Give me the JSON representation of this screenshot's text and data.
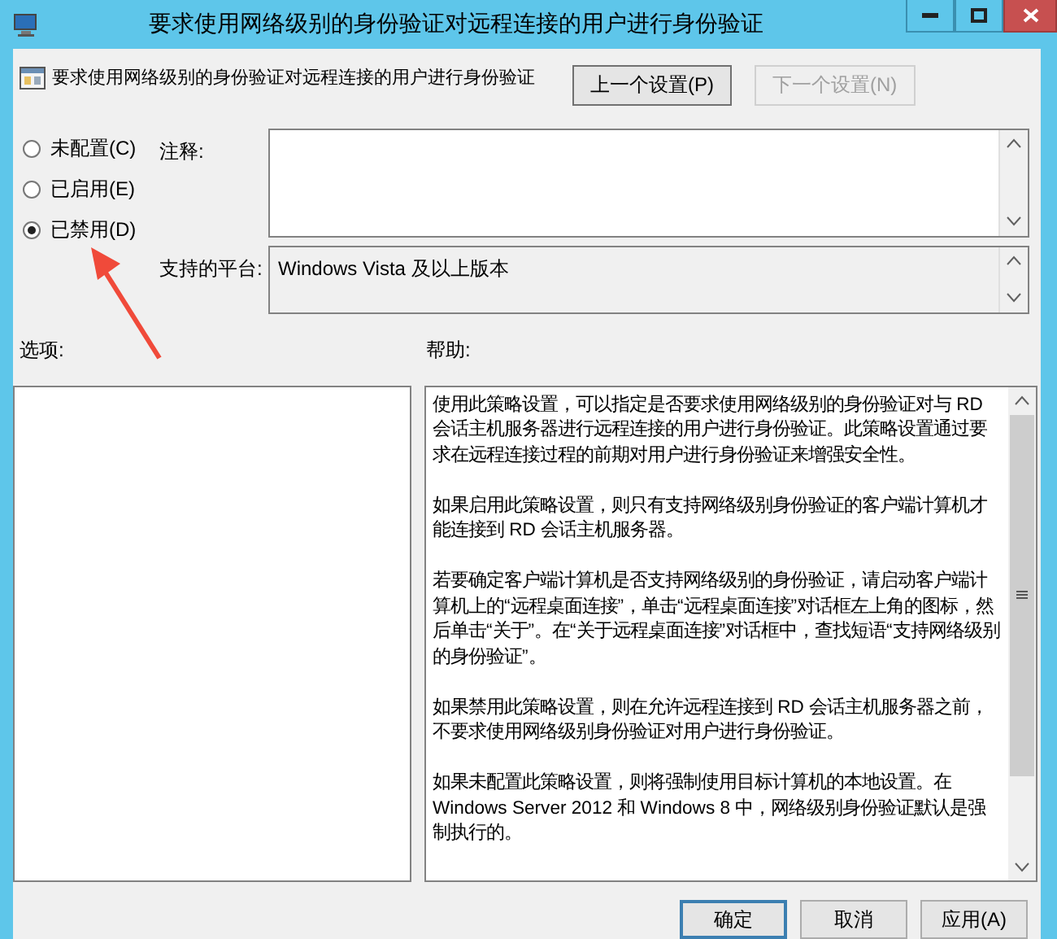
{
  "window": {
    "title": "要求使用网络级别的身份验证对远程连接的用户进行身份验证"
  },
  "header": {
    "policy_name": "要求使用网络级别的身份验证对远程连接的用户进行身份验证",
    "buttons": [
      {
        "label": "上一个设置(P)",
        "disabled": false
      },
      {
        "label": "下一个设置(N)",
        "disabled": true
      }
    ]
  },
  "state_options": [
    {
      "label": "未配置(C)",
      "selected": false
    },
    {
      "label": "已启用(E)",
      "selected": false
    },
    {
      "label": "已禁用(D)",
      "selected": true
    }
  ],
  "comment": {
    "label": "注释:"
  },
  "platform": {
    "label": "支持的平台:",
    "value": "Windows Vista 及以上版本"
  },
  "options_panel": {
    "label": "选项:"
  },
  "help": {
    "label": "帮助:",
    "paragraphs": [
      "使用此策略设置，可以指定是否要求使用网络级别的身份验证对与 RD 会话主机服务器进行远程连接的用户进行身份验证。此策略设置通过要求在远程连接过程的前期对用户进行身份验证来增强安全性。",
      "如果启用此策略设置，则只有支持网络级别身份验证的客户端计算机才能连接到 RD 会话主机服务器。",
      "若要确定客户端计算机是否支持网络级别的身份验证，请启动客户端计算机上的“远程桌面连接”，单击“远程桌面连接”对话框左上角的图标，然后单击“关于”。在“关于远程桌面连接”对话框中，查找短语“支持网络级别的身份验证”。",
      "如果禁用此策略设置，则在允许远程连接到 RD 会话主机服务器之前，不要求使用网络级别身份验证对用户进行身份验证。",
      "如果未配置此策略设置，则将强制使用目标计算机的本地设置。在 Windows Server 2012 和 Windows 8 中，网络级别身份验证默认是强制执行的。"
    ]
  },
  "footer_buttons": [
    {
      "label": "确定"
    },
    {
      "label": "取消"
    },
    {
      "label": "应用(A)"
    }
  ]
}
